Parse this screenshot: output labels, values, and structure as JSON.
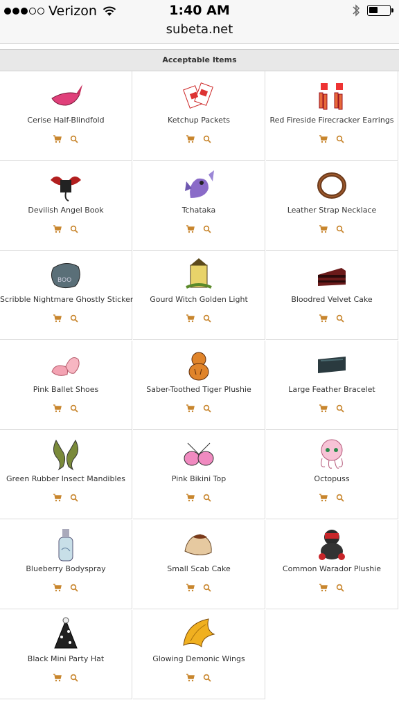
{
  "status": {
    "carrier": "Verizon",
    "time": "1:40 AM"
  },
  "browser": {
    "url": "subeta.net"
  },
  "section": {
    "title": "Acceptable Items"
  },
  "colors": {
    "accent": "#c8862e",
    "header_bg": "#e8e8e8"
  },
  "items": [
    {
      "name": "Cerise Half-Blindfold",
      "icon": "blindfold-icon"
    },
    {
      "name": "Ketchup Packets",
      "icon": "ketchup-icon"
    },
    {
      "name": "Red Fireside Firecracker Earrings",
      "icon": "firecracker-icon"
    },
    {
      "name": "Devilish Angel Book",
      "icon": "devil-book-icon"
    },
    {
      "name": "Tchataka",
      "icon": "tchataka-icon"
    },
    {
      "name": "Leather Strap Necklace",
      "icon": "necklace-icon"
    },
    {
      "name": "Scribble Nightmare Ghostly Sticker",
      "icon": "sticker-icon"
    },
    {
      "name": "Gourd Witch Golden Light",
      "icon": "lantern-icon"
    },
    {
      "name": "Bloodred Velvet Cake",
      "icon": "cake-icon"
    },
    {
      "name": "Pink Ballet Shoes",
      "icon": "ballet-shoes-icon"
    },
    {
      "name": "Saber-Toothed Tiger Plushie",
      "icon": "tiger-plushie-icon"
    },
    {
      "name": "Large Feather Bracelet",
      "icon": "bracelet-icon"
    },
    {
      "name": "Green Rubber Insect Mandibles",
      "icon": "mandibles-icon"
    },
    {
      "name": "Pink Bikini Top",
      "icon": "bikini-icon"
    },
    {
      "name": "Octopuss",
      "icon": "octopuss-icon"
    },
    {
      "name": "Blueberry Bodyspray",
      "icon": "bodyspray-icon"
    },
    {
      "name": "Small Scab Cake",
      "icon": "scab-cake-icon"
    },
    {
      "name": "Common Warador Plushie",
      "icon": "warador-plushie-icon"
    },
    {
      "name": "Black Mini Party Hat",
      "icon": "party-hat-icon"
    },
    {
      "name": "Glowing Demonic Wings",
      "icon": "wings-icon"
    }
  ]
}
